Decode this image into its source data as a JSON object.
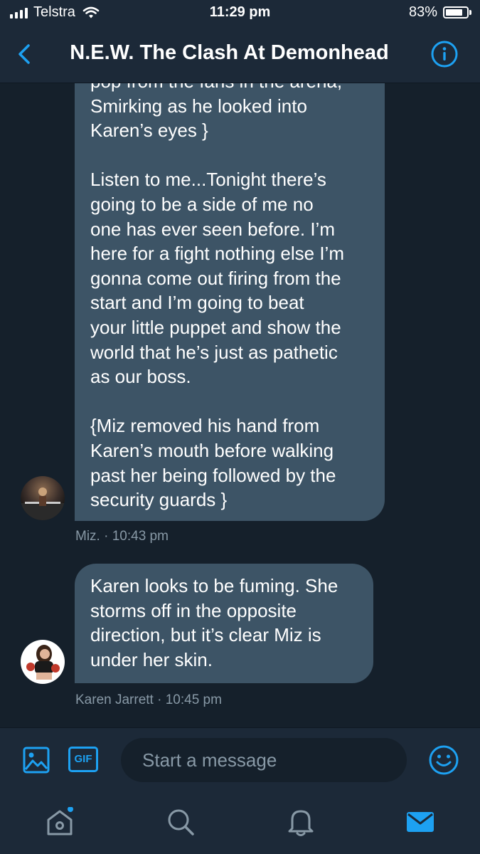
{
  "status_bar": {
    "carrier": "Telstra",
    "time": "11:29 pm",
    "battery_percent": "83%",
    "battery_level": 0.83
  },
  "header": {
    "title": "N.E.W. The Clash At Demonhead",
    "back_icon": "chevron-left-icon",
    "info_icon": "info-icon"
  },
  "messages": [
    {
      "text": "pop from the fans in the arena,\nSmirking as he looked into\nKaren’s eyes }\n\nListen to me...Tonight there’s\ngoing to be a side of me no\none has ever seen before. I’m\nhere for a fight nothing else I’m\ngonna come out firing from the\nstart and I’m going to beat\nyour little puppet and show the\nworld that he’s just as pathetic\nas our boss.\n\n{Miz removed his hand from\nKaren’s mouth before walking\npast her being followed by the\nsecurity guards }",
      "meta": "Miz. · 10:43 pm"
    },
    {
      "text": "Karen looks to be fuming. She\nstorms off in the opposite\ndirection, but it’s clear Miz is\nunder her skin.",
      "meta": "Karen Jarrett · 10:45 pm"
    }
  ],
  "composer": {
    "placeholder": "Start a message",
    "gif_label": "GIF",
    "icons": [
      "image-icon",
      "gif-icon",
      "emoji-icon"
    ]
  },
  "tabs": [
    "home-icon",
    "search-icon",
    "notifications-icon",
    "messages-icon"
  ],
  "colors": {
    "accent": "#1da1f2",
    "background": "#15202b",
    "bar": "#1c2938",
    "bubble": "#3d5466",
    "meta": "#8899a6"
  }
}
